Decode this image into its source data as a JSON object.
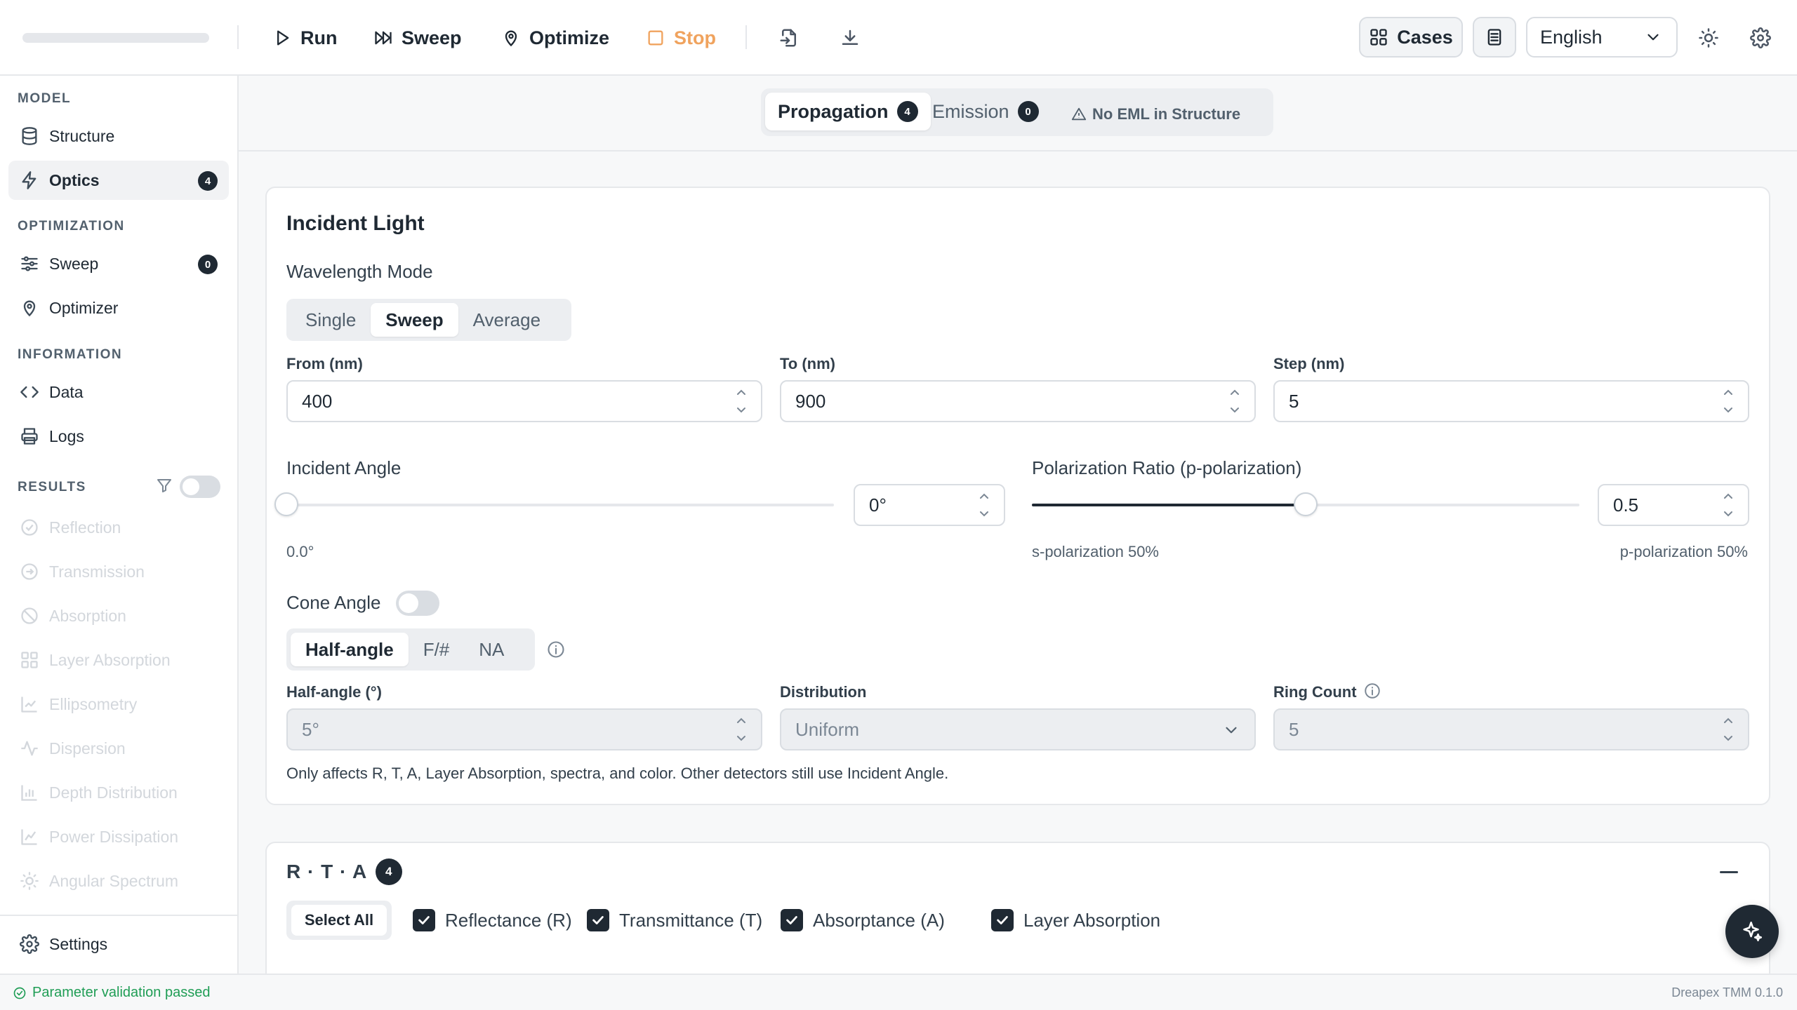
{
  "toolbar": {
    "run_label": "Run",
    "sweep_label": "Sweep",
    "optimize_label": "Optimize",
    "stop_label": "Stop",
    "cases_label": "Cases",
    "language": "English",
    "stop_color": "#f0a35e"
  },
  "sidebar": {
    "sections": {
      "model": "MODEL",
      "optimization": "OPTIMIZATION",
      "information": "INFORMATION",
      "results": "RESULTS"
    },
    "items": {
      "structure": "Structure",
      "optics": "Optics",
      "optics_badge": "4",
      "sweep": "Sweep",
      "sweep_badge": "0",
      "optimizer": "Optimizer",
      "data": "Data",
      "logs": "Logs",
      "settings": "Settings"
    },
    "results_items": [
      "Reflection",
      "Transmission",
      "Absorption",
      "Layer Absorption",
      "Ellipsometry",
      "Dispersion",
      "Depth Distribution",
      "Power Dissipation",
      "Angular Spectrum"
    ],
    "results_enabled": false
  },
  "tabs": {
    "propagation": "Propagation",
    "propagation_badge": "4",
    "emission": "Emission",
    "emission_badge": "0",
    "warning": "No EML in Structure"
  },
  "incident_light": {
    "title": "Incident Light",
    "wavelength_mode_label": "Wavelength Mode",
    "modes": [
      "Single",
      "Sweep",
      "Average"
    ],
    "active_mode": "Sweep",
    "from_label": "From (nm)",
    "from_value": "400",
    "to_label": "To (nm)",
    "to_value": "900",
    "step_label": "Step (nm)",
    "step_value": "5",
    "incident_angle_label": "Incident Angle",
    "incident_angle_input": "0°",
    "incident_angle_readout": "0.0°",
    "incident_angle_level": 0,
    "polarization_label": "Polarization Ratio (p-polarization)",
    "polarization_value": "0.5",
    "polarization_level": 0.5,
    "s_pol_hint": "s-polarization 50%",
    "p_pol_hint": "p-polarization 50%",
    "cone_angle_label": "Cone Angle",
    "cone_angle_enabled": false,
    "cone_modes": [
      "Half-angle",
      "F/#",
      "NA"
    ],
    "active_cone_mode": "Half-angle",
    "half_angle_label": "Half-angle (°)",
    "half_angle_value": "5°",
    "distribution_label": "Distribution",
    "distribution_value": "Uniform",
    "ring_count_label": "Ring Count",
    "ring_count_value": "5",
    "note": "Only affects R, T, A, Layer Absorption, spectra, and color. Other detectors still use Incident Angle."
  },
  "rta": {
    "title": "R · T · A",
    "badge": "4",
    "select_all": "Select All",
    "checks": [
      "Reflectance (R)",
      "Transmittance (T)",
      "Absorptance (A)",
      "Layer Absorption"
    ]
  },
  "status": {
    "message": "Parameter validation passed",
    "version": "Dreapex TMM 0.1.0",
    "ok_color": "#1f9d55"
  }
}
